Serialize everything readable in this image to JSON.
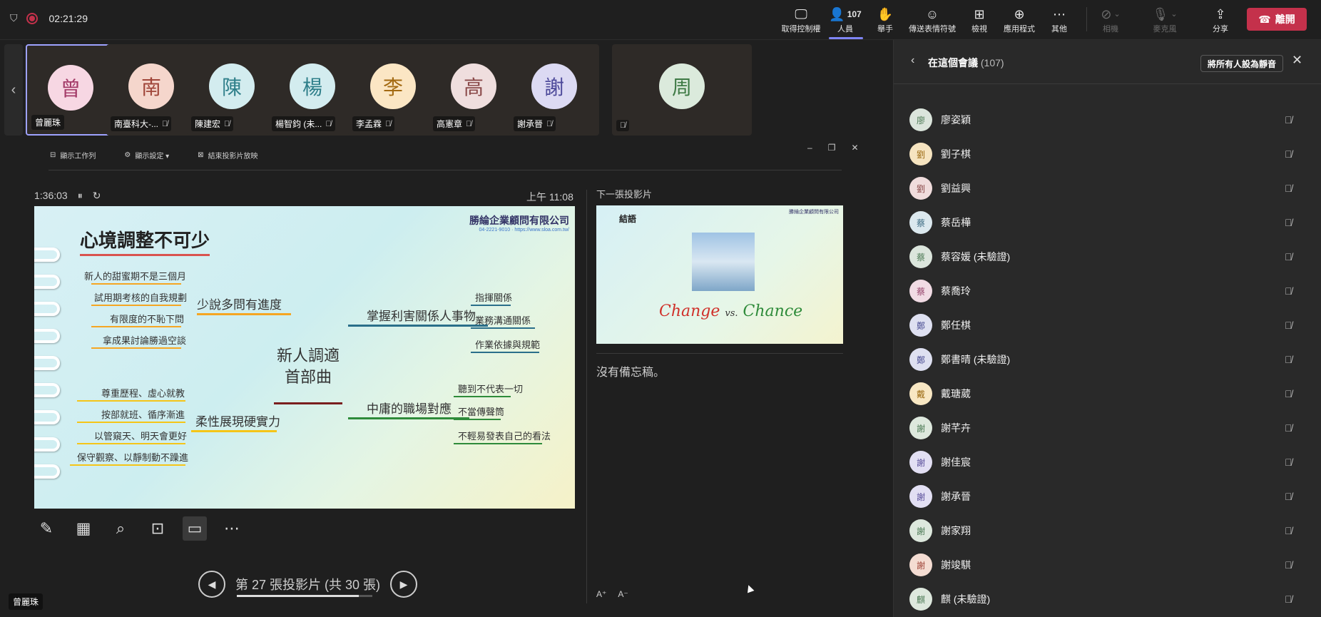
{
  "topbar": {
    "timer": "02:21:29",
    "buttons": {
      "take_control": "取得控制權",
      "people": "人員",
      "people_count": "107",
      "raise_hand": "舉手",
      "reactions": "傳送表情符號",
      "view": "檢視",
      "apps": "應用程式",
      "more": "其他",
      "camera": "相機",
      "mic": "麥克風",
      "share": "分享",
      "leave": "離開"
    }
  },
  "participants_strip": [
    {
      "initial": "曾",
      "name": "曾麗珠",
      "avatar_color": "#f7d7e3",
      "text_color": "#a33b68",
      "muted": false,
      "active": true
    },
    {
      "initial": "南",
      "name": "南臺科大-...",
      "avatar_color": "#f5d6cc",
      "text_color": "#a0463a",
      "muted": true,
      "active": false
    },
    {
      "initial": "陳",
      "name": "陳建宏",
      "avatar_color": "#d3ecef",
      "text_color": "#2f7f8a",
      "muted": true,
      "active": false
    },
    {
      "initial": "楊",
      "name": "楊智鈞 (未...",
      "avatar_color": "#d3ecef",
      "text_color": "#2f7f8a",
      "muted": true,
      "active": false
    },
    {
      "initial": "李",
      "name": "李孟霖",
      "avatar_color": "#fbe6c4",
      "text_color": "#a36a12",
      "muted": true,
      "active": false
    },
    {
      "initial": "高",
      "name": "高憲章",
      "avatar_color": "#efdede",
      "text_color": "#8a4a4a",
      "muted": true,
      "active": false
    },
    {
      "initial": "謝",
      "name": "謝承晉",
      "avatar_color": "#dcdaf3",
      "text_color": "#4d4a9a",
      "muted": true,
      "active": false
    },
    {
      "initial": "周",
      "name": "",
      "avatar_color": "#dbeadc",
      "text_color": "#3e7a45",
      "muted": true,
      "active": false
    }
  ],
  "presenter": {
    "toolbar": {
      "taskbar": "顯示工作列",
      "display_settings": "顯示設定 ▾",
      "end_show": "結束投影片放映"
    },
    "elapsed": "1:36:03",
    "clock": "上午 11:08",
    "next_label": "下一張投影片",
    "notes": "沒有備忘稿。",
    "slide_counter": "第 27 張投影片 (共 30 張)",
    "progress": 0.9
  },
  "current_slide": {
    "title": "心境調整不可少",
    "company": "勝綸企業顧問有限公司",
    "phone": "04-2221-9010",
    "website": "https://www.sloa.com.tw/",
    "center": [
      "新人調適",
      "首部曲"
    ],
    "branches": [
      {
        "label": "少說多問有進度",
        "color": "#f5a623",
        "leaves": [
          "新人的甜蜜期不是三個月",
          "試用期考核的自我規劃",
          "有限度的不恥下問",
          "拿成果討論勝過空談"
        ]
      },
      {
        "label": "柔性展現硬實力",
        "color": "#f5c518",
        "leaves": [
          "尊重歷程、虛心就教",
          "按部就班、循序漸進",
          "以管窺天、明天會更好",
          "保守觀察、以靜制動不躁進"
        ]
      },
      {
        "label": "掌握利害關係人事物",
        "color": "#2a6f8a",
        "leaves": [
          "指揮關係",
          "業務溝通關係",
          "作業依據與規範"
        ]
      },
      {
        "label": "中庸的職場對應",
        "color": "#2e8b3a",
        "leaves": [
          "聽到不代表一切",
          "不當傳聲筒",
          "不輕易發表自己的看法"
        ]
      }
    ]
  },
  "next_slide": {
    "title": "結語",
    "change": "Change",
    "vs": "vs.",
    "chance": "Chance",
    "company": "勝綸企業顧問有限公司"
  },
  "self_label": "曾麗珠",
  "panel": {
    "title": "在這個會議",
    "count": "(107)",
    "mute_all": "將所有人設為靜音",
    "people": [
      {
        "initial": "廖",
        "name": "廖姿穎",
        "color": "#dbe5dc",
        "tc": "#4c7a55"
      },
      {
        "initial": "劉",
        "name": "劉子棋",
        "color": "#f6e4c0",
        "tc": "#9b6a12"
      },
      {
        "initial": "劉",
        "name": "劉益興",
        "color": "#f0dcdc",
        "tc": "#8a4a4a"
      },
      {
        "initial": "蔡",
        "name": "蔡岳樺",
        "color": "#dbe8ee",
        "tc": "#3b6a82"
      },
      {
        "initial": "蔡",
        "name": "蔡容媛 (未驗證)",
        "color": "#dbe5dc",
        "tc": "#4c7a55"
      },
      {
        "initial": "蔡",
        "name": "蔡喬玲",
        "color": "#f1dbe4",
        "tc": "#95426a"
      },
      {
        "initial": "鄭",
        "name": "鄭任棋",
        "color": "#dee0f1",
        "tc": "#4c4f94"
      },
      {
        "initial": "鄭",
        "name": "鄭書晴 (未驗證)",
        "color": "#dee0f1",
        "tc": "#4c4f94"
      },
      {
        "initial": "戴",
        "name": "戴瑭葳",
        "color": "#f8e7c3",
        "tc": "#9b6a12"
      },
      {
        "initial": "謝",
        "name": "謝芊卉",
        "color": "#dde8dd",
        "tc": "#4c7a55"
      },
      {
        "initial": "謝",
        "name": "謝佳宸",
        "color": "#e2dff3",
        "tc": "#5a4f9a"
      },
      {
        "initial": "謝",
        "name": "謝承晉",
        "color": "#e2dff3",
        "tc": "#5a4f9a"
      },
      {
        "initial": "謝",
        "name": "謝家翔",
        "color": "#dde8dd",
        "tc": "#4c7a55"
      },
      {
        "initial": "謝",
        "name": "謝竣騏",
        "color": "#f4dcd2",
        "tc": "#a0463a"
      },
      {
        "initial": "麒",
        "name": "麒 (未驗證)",
        "color": "#dde8dd",
        "tc": "#4c7a55"
      }
    ]
  }
}
